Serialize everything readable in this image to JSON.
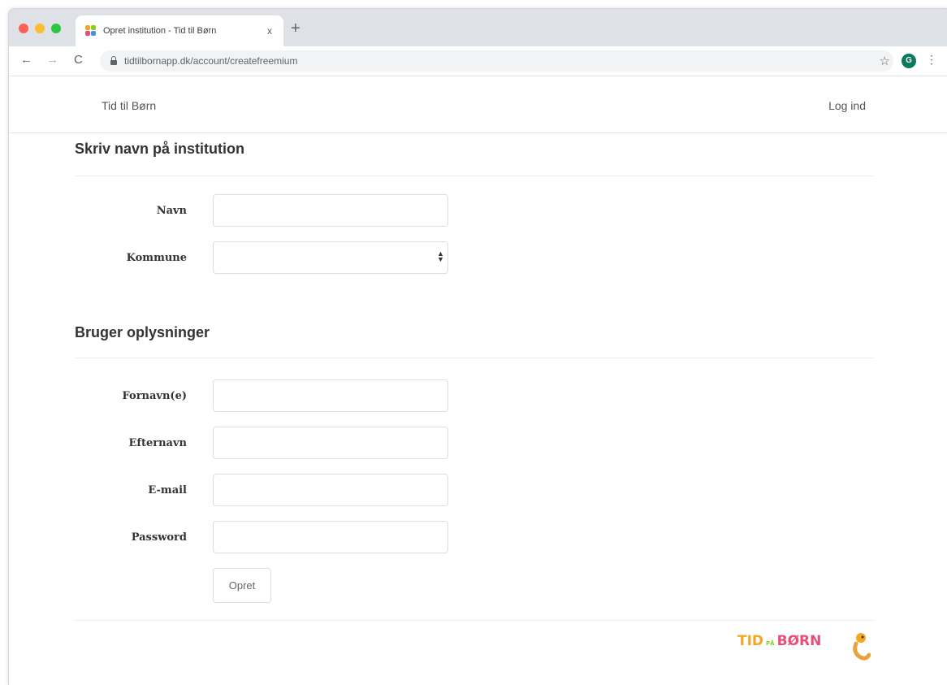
{
  "browser": {
    "tab_title": "Opret institution - Tid til Børn",
    "tab_close": "x",
    "new_tab": "+",
    "url": "tidtilbornapp.dk/account/createfreemium",
    "avatar_letter": "G",
    "nav": {
      "back": "←",
      "forward": "→",
      "reload": "C"
    },
    "star": "☆",
    "menu": "⋮"
  },
  "header": {
    "brand": "Tid til Børn",
    "login": "Log ind"
  },
  "institution_section": {
    "title": "Skriv navn på institution",
    "fields": [
      {
        "label": "Navn",
        "value": ""
      },
      {
        "label": "Kommune",
        "value": ""
      }
    ]
  },
  "user_section": {
    "title": "Bruger oplysninger",
    "fields": [
      {
        "label": "Fornavn(e)",
        "value": ""
      },
      {
        "label": "Efternavn",
        "value": ""
      },
      {
        "label": "E-mail",
        "value": ""
      },
      {
        "label": "Password",
        "value": ""
      }
    ],
    "submit": "Opret"
  },
  "logo": {
    "part1": "TID",
    "part2": "PÅ",
    "part3": "BØRN",
    "colors": {
      "tid": "#f5a623",
      "pa": "#7ed321",
      "born": "#e94e77",
      "accent": "#4a90e2"
    }
  }
}
